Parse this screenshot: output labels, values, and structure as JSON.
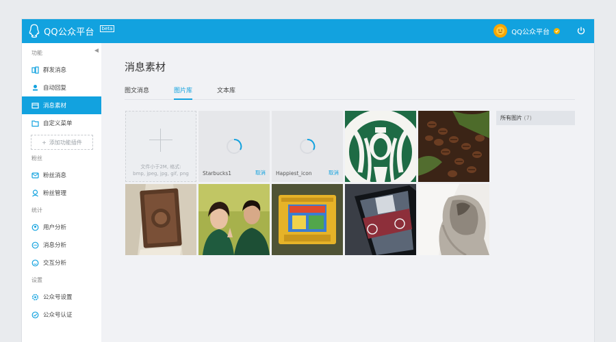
{
  "app": {
    "title": "QQ公众平台",
    "beta": "beta"
  },
  "account": {
    "name": "QQ公众平台"
  },
  "sidebar": {
    "groups": [
      {
        "title": "功能",
        "items": [
          {
            "label": "群发消息",
            "icon": "send-icon"
          },
          {
            "label": "自动回复",
            "icon": "auto-reply-icon"
          },
          {
            "label": "消息素材",
            "icon": "material-icon",
            "active": true
          },
          {
            "label": "自定义菜单",
            "icon": "menu-icon"
          }
        ]
      },
      {
        "title": "粉丝",
        "items": [
          {
            "label": "粉丝消息",
            "icon": "message-icon"
          },
          {
            "label": "粉丝管理",
            "icon": "fans-icon"
          }
        ]
      },
      {
        "title": "统计",
        "items": [
          {
            "label": "用户分析",
            "icon": "user-analysis-icon"
          },
          {
            "label": "消息分析",
            "icon": "message-analysis-icon"
          },
          {
            "label": "交互分析",
            "icon": "interaction-analysis-icon"
          }
        ]
      },
      {
        "title": "设置",
        "items": [
          {
            "label": "公众号设置",
            "icon": "settings-icon"
          },
          {
            "label": "公众号认证",
            "icon": "verify-icon"
          }
        ]
      }
    ],
    "add_plugin_label": "添加功能插件"
  },
  "main": {
    "title": "消息素材",
    "tabs": [
      {
        "label": "图文消息",
        "active": false
      },
      {
        "label": "图片库",
        "active": true
      },
      {
        "label": "文本库",
        "active": false
      }
    ],
    "upload_hint_line1": "文件小于2M, 格式:",
    "upload_hint_line2": "bmp, jpeg, jpg, gif, png",
    "uploading": [
      {
        "filename": "Starbucks1",
        "cancel_label": "取消"
      },
      {
        "filename": "Happiest_icon",
        "cancel_label": "取消"
      }
    ],
    "side_panel": {
      "label": "所有图片",
      "count": "(7)"
    }
  },
  "colors": {
    "brand": "#12a2df",
    "sidebar_bg": "#ffffff",
    "content_bg": "#f1f2f5"
  }
}
